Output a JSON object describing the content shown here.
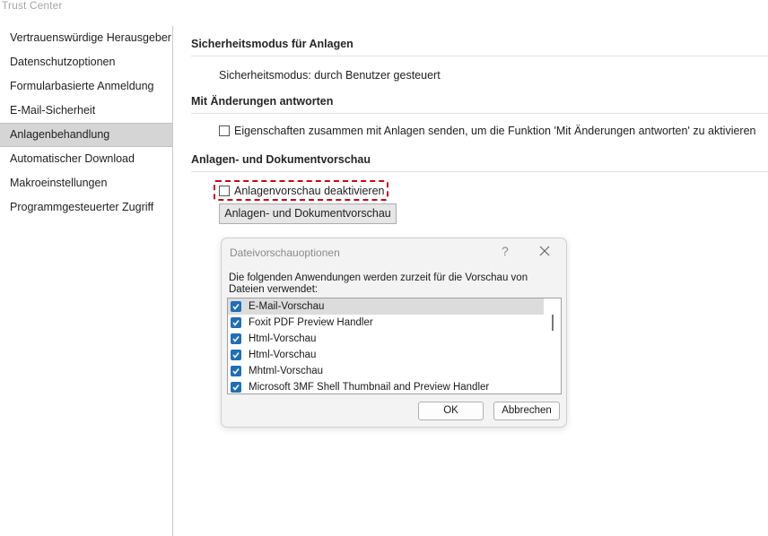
{
  "window": {
    "title": "Trust Center"
  },
  "sidebar": {
    "items": [
      {
        "label": "Vertrauenswürdige Herausgeber"
      },
      {
        "label": "Datenschutzoptionen"
      },
      {
        "label": "Formularbasierte Anmeldung"
      },
      {
        "label": "E-Mail-Sicherheit"
      },
      {
        "label": "Anlagenbehandlung",
        "selected": true
      },
      {
        "label": "Automatischer Download"
      },
      {
        "label": "Makroeinstellungen"
      },
      {
        "label": "Programmgesteuerter Zugriff"
      }
    ]
  },
  "main": {
    "section1": {
      "header": "Sicherheitsmodus für Anlagen",
      "text": "Sicherheitsmodus: durch Benutzer gesteuert"
    },
    "section2": {
      "header": "Mit Änderungen antworten",
      "checkbox_label": "Eigenschaften zusammen mit Anlagen senden, um die Funktion 'Mit Änderungen antworten' zu aktivieren",
      "checked": false
    },
    "section3": {
      "header": "Anlagen- und Dokumentvorschau",
      "checkbox_label": "Anlagenvorschau deaktivieren",
      "checked": false,
      "button_label": "Anlagen- und Dokumentvorschau"
    }
  },
  "dialog": {
    "title": "Dateivorschauoptionen",
    "help": "?",
    "description": "Die folgenden Anwendungen werden zurzeit für die Vorschau von Dateien verwendet:",
    "items": [
      {
        "label": "E-Mail-Vorschau",
        "checked": true
      },
      {
        "label": "Foxit PDF Preview Handler",
        "checked": true
      },
      {
        "label": "Html-Vorschau",
        "checked": true
      },
      {
        "label": "Html-Vorschau",
        "checked": true
      },
      {
        "label": "Mhtml-Vorschau",
        "checked": true
      },
      {
        "label": "Microsoft 3MF Shell Thumbnail and Preview Handler",
        "checked": true
      }
    ],
    "ok_label": "OK",
    "cancel_label": "Abbrechen"
  },
  "colors": {
    "accent": "#1d6fb8",
    "highlight": "#d0021b",
    "sidebar_selected": "#d5d5d5"
  }
}
